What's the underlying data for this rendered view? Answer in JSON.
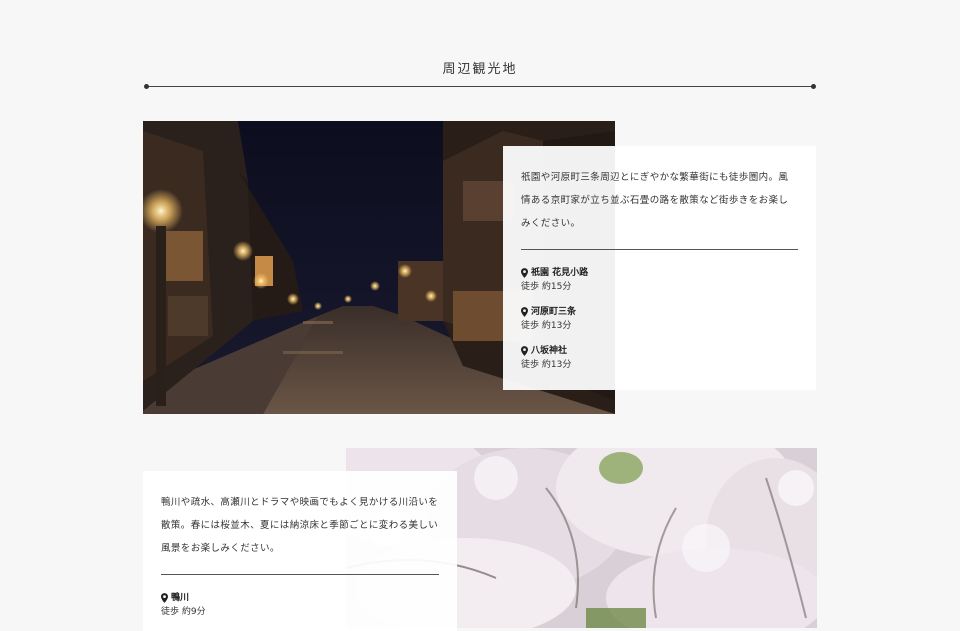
{
  "section": {
    "title": "周辺観光地"
  },
  "cards": [
    {
      "description": "祇園や河原町三条周辺とにぎやかな繁華街にも徒歩圏内。風情ある京町家が立ち並ぶ石畳の路を散策など街歩きをお楽しみください。",
      "spots": [
        {
          "name": "祇園 花見小路",
          "walk": "徒歩 約15分",
          "icon": "map-pin-icon"
        },
        {
          "name": "河原町三条",
          "walk": "徒歩 約13分",
          "icon": "map-pin-icon"
        },
        {
          "name": "八坂神社",
          "walk": "徒歩 約13分",
          "icon": "map-pin-icon"
        }
      ]
    },
    {
      "description": "鴨川や疏水、高瀬川とドラマや映画でもよく見かける川沿いを散策。春には桜並木、夏には納涼床と季節ごとに変わる美しい風景をお楽しみください。",
      "spots": [
        {
          "name": "鴨川",
          "walk": "徒歩 約9分",
          "icon": "map-pin-icon"
        }
      ]
    }
  ],
  "colors": {
    "background": "#f7f7f7",
    "card": "#ffffff",
    "text": "#222222"
  }
}
